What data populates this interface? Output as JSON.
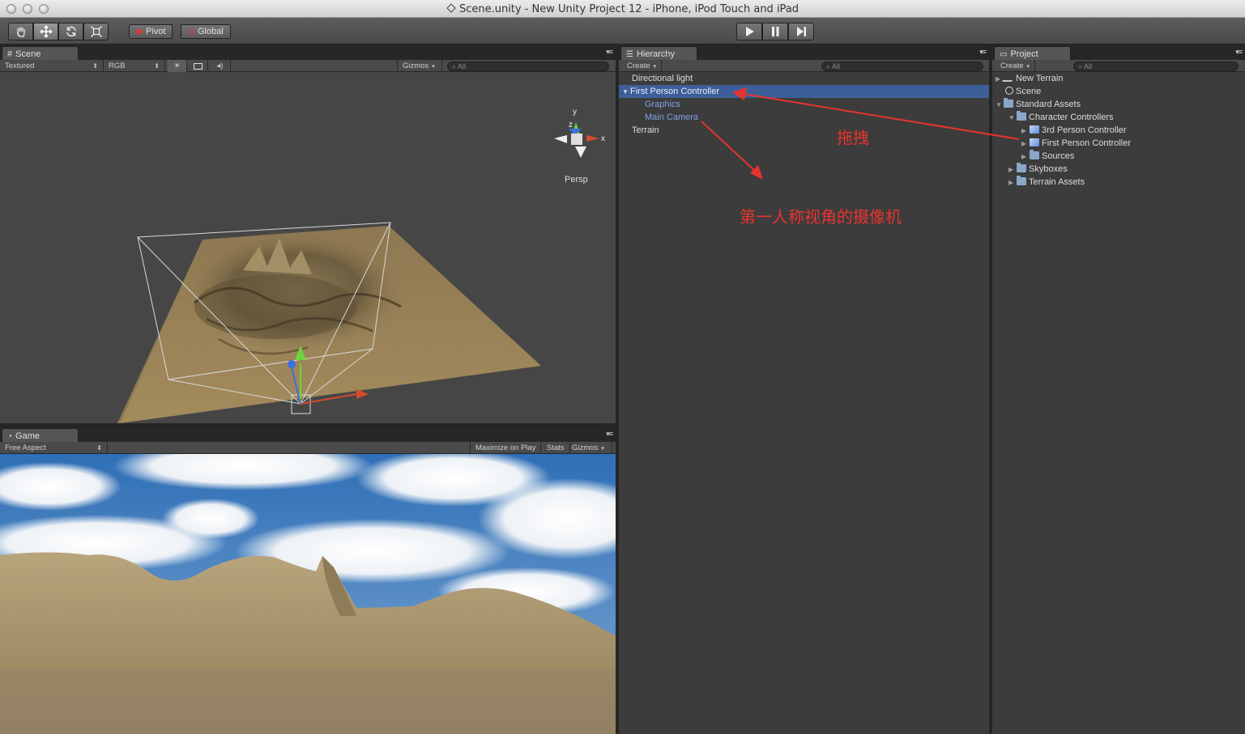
{
  "window": {
    "title": "Scene.unity - New Unity Project 12 - iPhone, iPod Touch and iPad"
  },
  "toolbar": {
    "pivot_label": "Pivot",
    "global_label": "Global"
  },
  "scene_panel": {
    "tab_label": "Scene",
    "render_mode": "Textured",
    "color_mode": "RGB",
    "gizmos_label": "Gizmos",
    "search_placeholder": "All",
    "axis_y": "y",
    "axis_x": "x",
    "axis_z": "z",
    "projection_label": "Persp"
  },
  "game_panel": {
    "tab_label": "Game",
    "aspect": "Free Aspect",
    "maximize_label": "Maximize on Play",
    "stats_label": "Stats",
    "gizmos_label": "Gizmos"
  },
  "hierarchy_panel": {
    "tab_label": "Hierarchy",
    "create_label": "Create",
    "search_placeholder": "All",
    "items": [
      {
        "label": "Directional light"
      },
      {
        "label": "First Person Controller"
      },
      {
        "label": "Graphics"
      },
      {
        "label": "Main Camera"
      },
      {
        "label": "Terrain"
      }
    ]
  },
  "project_panel": {
    "tab_label": "Project",
    "create_label": "Create",
    "search_placeholder": "All",
    "items": [
      {
        "label": "New Terrain"
      },
      {
        "label": "Scene"
      },
      {
        "label": "Standard Assets"
      },
      {
        "label": "Character Controllers"
      },
      {
        "label": "3rd Person Controller"
      },
      {
        "label": "First Person Controller"
      },
      {
        "label": "Sources"
      },
      {
        "label": "Skyboxes"
      },
      {
        "label": "Terrain Assets"
      }
    ]
  },
  "annotations": {
    "drag_note": "拖拽",
    "camera_note": "第一人称视角的摄像机"
  },
  "colors": {
    "selection": "#3d5f99",
    "annotation": "#e8342e",
    "child_text": "#7fa0e8"
  }
}
